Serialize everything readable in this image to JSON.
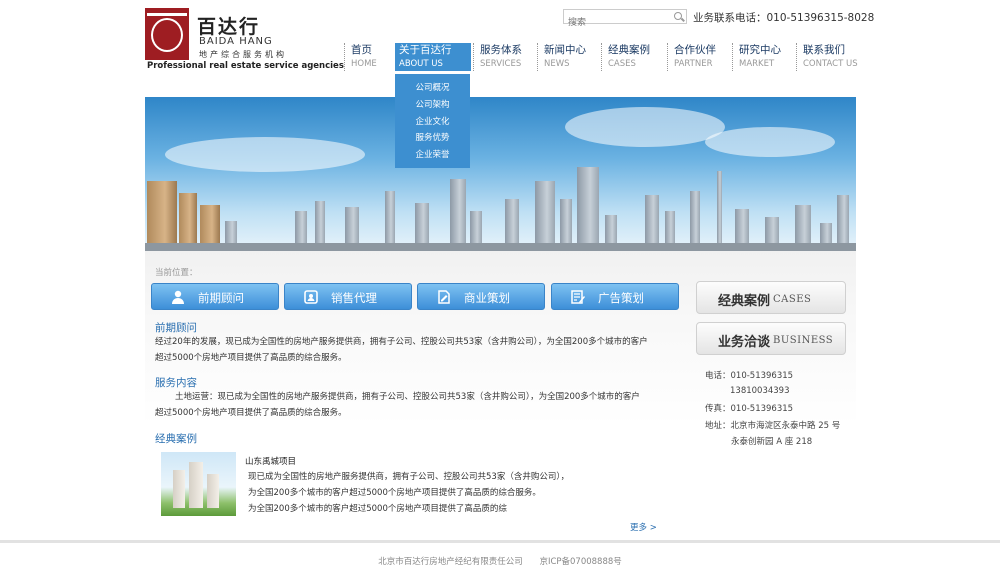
{
  "logo": {
    "name_cn": "百达行",
    "name_en": "BAIDA HANG",
    "subtitle_cn": "地产综合服务机构",
    "tagline": "Professional real estate service agencies"
  },
  "search": {
    "placeholder": "搜索"
  },
  "hotline": "业务联系电话：010-51396315-8028",
  "nav": [
    {
      "cn": "首页",
      "en": "HOME"
    },
    {
      "cn": "关于百达行",
      "en": "ABOUT US"
    },
    {
      "cn": "服务体系",
      "en": "SERVICES"
    },
    {
      "cn": "新闻中心",
      "en": "NEWS"
    },
    {
      "cn": "经典案例",
      "en": "CASES"
    },
    {
      "cn": "合作伙伴",
      "en": "PARTNER"
    },
    {
      "cn": "研究中心",
      "en": "MARKET"
    },
    {
      "cn": "联系我们",
      "en": "CONTACT US"
    }
  ],
  "dropdown": [
    "公司概况",
    "公司架构",
    "企业文化",
    "服务优势",
    "企业荣誉"
  ],
  "breadcrumb": "当前位置：",
  "services": [
    "前期顾问",
    "销售代理",
    "商业策划",
    "广告策划"
  ],
  "sections": {
    "s1_title": "前期顾问",
    "s1_line1": "经过20年的发展，现已成为全国性的房地产服务提供商，拥有子公司、控股公司共53家（含井购公司），为全国200多个城市的客户",
    "s1_line2": "超过5000个房地产项目提供了高品质的综合服务。",
    "s2_title": "服务内容",
    "s2_line1": "土地运营：现已成为全国性的房地产服务提供商，拥有子公司、控股公司共53家（含井购公司），为全国200多个城市的客户",
    "s2_line2": "超过5000个房地产项目提供了高品质的综合服务。",
    "s3_title": "经典案例"
  },
  "case": {
    "title": "山东禹城项目",
    "line1": "现已成为全国性的房地产服务提供商，拥有子公司、控股公司共53家（含井购公司），",
    "line2": "为全国200多个城市的客户超过5000个房地产项目提供了高品质的综合服务。",
    "line3": "为全国200多个城市的客户超过5000个房地产项目提供了高品质的综"
  },
  "more": "更多 >",
  "side": {
    "cases_cn": "经典案例",
    "cases_en": "CASES",
    "business_cn": "业务洽谈",
    "business_en": "BUSINESS"
  },
  "contact": {
    "tel1": "电话：010-51396315",
    "tel2": "13810034393",
    "fax": "传真：010-51396315",
    "addr1": "地址：北京市海淀区永泰中路 25 号",
    "addr2": "永泰创新园 A 座 218"
  },
  "footer": {
    "company": "北京市百达行房地产经纪有限责任公司",
    "icp": "京ICP备07008888号"
  },
  "colors": {
    "accent": "#3d8fd0",
    "brand_red": "#9e1d22",
    "link": "#2a6fb0"
  }
}
